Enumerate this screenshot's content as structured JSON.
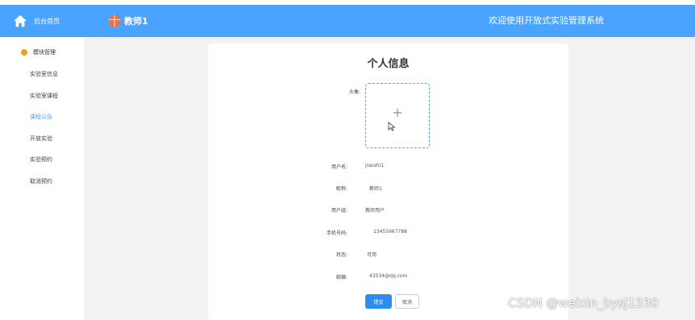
{
  "header": {
    "brand_label": "后台首页",
    "user_name": "教师1",
    "welcome_text": "欢迎使用开放式实验管理系统"
  },
  "sidebar": {
    "group_label": "模块管理",
    "items": [
      {
        "label": "实验室信息",
        "active": false
      },
      {
        "label": "实验室课程",
        "active": false
      },
      {
        "label": "课程公告",
        "active": true
      },
      {
        "label": "开放实验",
        "active": false
      },
      {
        "label": "实验预约",
        "active": false
      },
      {
        "label": "取消预约",
        "active": false
      }
    ]
  },
  "form": {
    "title": "个人信息",
    "avatar_label": "头像:",
    "upload_symbol": "+",
    "fields": [
      {
        "label": "用户名:",
        "value": "jiaoshi1"
      },
      {
        "label": "昵称:",
        "value": "教师1"
      },
      {
        "label": "用户组:",
        "value": "教师用户"
      },
      {
        "label": "手机号码:",
        "value": "13455667788"
      },
      {
        "label": "状态:",
        "value": "可用"
      },
      {
        "label": "邮箱:",
        "value": "43534@qq.com"
      }
    ],
    "submit_label": "提交",
    "cancel_label": "取消"
  },
  "watermark": "CSDN @weixin_bysj1330",
  "colors": {
    "header_bg": "#4aa3ff",
    "active_menu": "#4aa3ff",
    "primary_button": "#2d8cf0",
    "content_bg": "#f2f2f2"
  },
  "icons": {
    "brand": "home-icon",
    "user": "avatar-icon",
    "menu_group": "dot-icon",
    "cursor": "mouse-pointer-icon"
  }
}
